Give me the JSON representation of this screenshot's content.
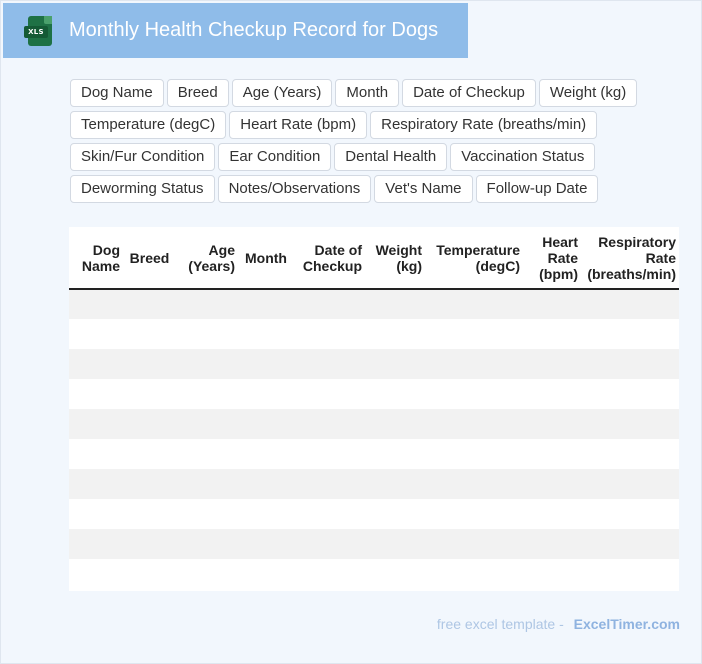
{
  "header": {
    "icon": "xls-file-icon",
    "icon_label": "XLS",
    "title": "Monthly Health Checkup Record for Dogs",
    "background": "#8fbce9"
  },
  "fields": [
    "Dog Name",
    "Breed",
    "Age (Years)",
    "Month",
    "Date of Checkup",
    "Weight (kg)",
    "Temperature (degC)",
    "Heart Rate (bpm)",
    "Respiratory Rate (breaths/min)",
    "Skin/Fur Condition",
    "Ear Condition",
    "Dental Health",
    "Vaccination Status",
    "Deworming Status",
    "Notes/Observations",
    "Vet's Name",
    "Follow-up Date"
  ],
  "table": {
    "columns": [
      [
        "Dog",
        "Name"
      ],
      [
        "Breed"
      ],
      [
        "Age",
        "(Years)"
      ],
      [
        "Month"
      ],
      [
        "Date of",
        "Checkup"
      ],
      [
        "Weight",
        "(kg)"
      ],
      [
        "Temperature",
        "(degC)"
      ],
      [
        "Heart",
        "Rate",
        "(bpm)"
      ],
      [
        "Respiratory",
        "Rate",
        "(breaths/min)"
      ]
    ],
    "empty_rows": 10,
    "row_shade": "#f2f2f2"
  },
  "footer": {
    "label": "free excel template -",
    "brand": "ExcelTimer.com"
  }
}
